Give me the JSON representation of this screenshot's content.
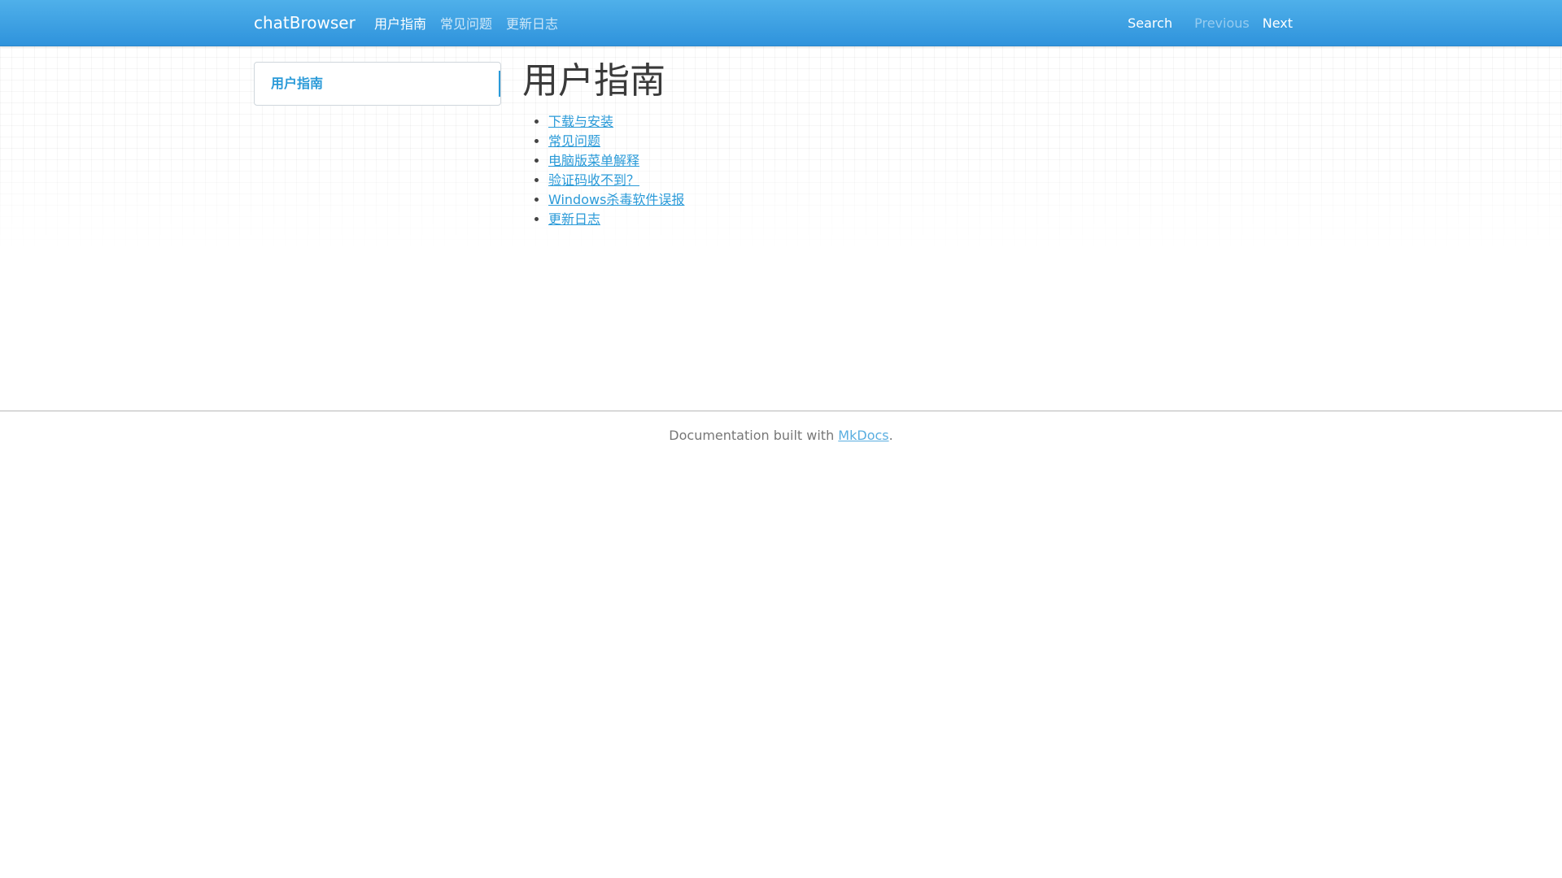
{
  "navbar": {
    "brand": "chatBrowser",
    "links": [
      {
        "label": "用户指南",
        "active": true
      },
      {
        "label": "常见问题",
        "active": false
      },
      {
        "label": "更新日志",
        "active": false
      }
    ],
    "search_label": "Search",
    "previous_label": "Previous",
    "next_label": "Next",
    "accent_color": "#2f93dc"
  },
  "sidebar": {
    "active_item": "用户指南",
    "accent_color": "#2a9ad8"
  },
  "main": {
    "title": "用户指南",
    "items": [
      "下载与安装",
      "常见问题",
      "电脑版菜单解释",
      "验证码收不到？",
      "Windows杀毒软件误报",
      "更新日志"
    ]
  },
  "footer": {
    "prefix": "Documentation built with ",
    "link_label": "MkDocs",
    "suffix": "."
  }
}
